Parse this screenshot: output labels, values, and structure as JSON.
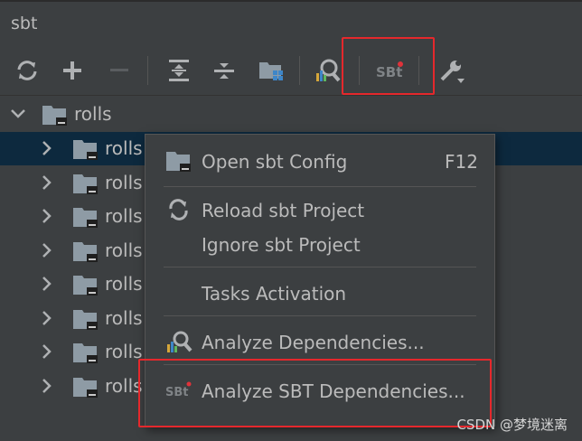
{
  "panel": {
    "title": "sbt"
  },
  "toolbar": {
    "buttons": [
      {
        "name": "refresh-icon"
      },
      {
        "name": "plus-icon"
      },
      {
        "name": "minus-icon"
      },
      {
        "name": "expand-all-icon"
      },
      {
        "name": "collapse-all-icon"
      },
      {
        "name": "folder-modules-icon"
      },
      {
        "name": "analyze-dependencies-icon"
      },
      {
        "name": "sbt-icon"
      },
      {
        "name": "wrench-icon"
      }
    ]
  },
  "tree": {
    "root": {
      "label": "rolls",
      "expanded": true
    },
    "children": [
      "rolls",
      "rolls",
      "rolls",
      "rolls",
      "rolls",
      "rolls",
      "rolls",
      "rolls"
    ],
    "selected_index": 0
  },
  "menu": {
    "open_config": {
      "label": "Open sbt Config",
      "shortcut": "F12"
    },
    "reload": {
      "label": "Reload sbt Project"
    },
    "ignore": {
      "label": "Ignore sbt Project"
    },
    "tasks": {
      "label": "Tasks Activation"
    },
    "analyze": {
      "label": "Analyze Dependencies..."
    },
    "analyze_sbt": {
      "label": "Analyze SBT Dependencies..."
    }
  },
  "watermark": "CSDN @梦境迷离",
  "colors": {
    "background": "#3c3f41",
    "selection": "#0d293e",
    "text": "#bbbbbb",
    "highlight_box": "#e5282c"
  }
}
